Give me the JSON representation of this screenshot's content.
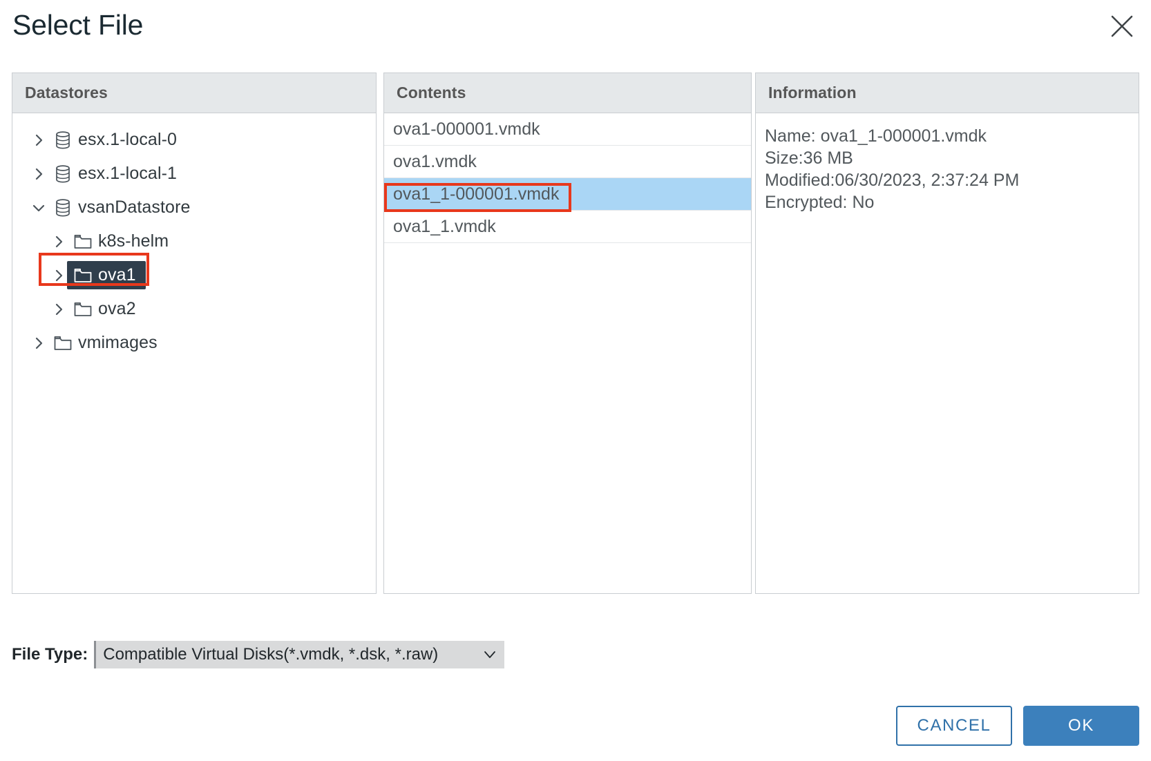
{
  "dialog": {
    "title": "Select File",
    "close_icon": "close-icon"
  },
  "panels": {
    "datastores": {
      "header": "Datastores",
      "tree": [
        {
          "label": "esx.1-local-0",
          "icon": "datastore-icon",
          "level": 0,
          "expanded": false,
          "selected": false
        },
        {
          "label": "esx.1-local-1",
          "icon": "datastore-icon",
          "level": 0,
          "expanded": false,
          "selected": false
        },
        {
          "label": "vsanDatastore",
          "icon": "datastore-icon",
          "level": 0,
          "expanded": true,
          "selected": false
        },
        {
          "label": "k8s-helm",
          "icon": "folder-icon",
          "level": 1,
          "expanded": false,
          "selected": false
        },
        {
          "label": "ova1",
          "icon": "folder-icon",
          "level": 1,
          "expanded": false,
          "selected": true
        },
        {
          "label": "ova2",
          "icon": "folder-icon",
          "level": 1,
          "expanded": false,
          "selected": false
        },
        {
          "label": "vmimages",
          "icon": "folder-icon",
          "level": 0,
          "expanded": false,
          "selected": false
        }
      ]
    },
    "contents": {
      "header": "Contents",
      "files": [
        {
          "name": "ova1-000001.vmdk",
          "selected": false
        },
        {
          "name": "ova1.vmdk",
          "selected": false
        },
        {
          "name": "ova1_1-000001.vmdk",
          "selected": true
        },
        {
          "name": "ova1_1.vmdk",
          "selected": false
        }
      ]
    },
    "information": {
      "header": "Information",
      "lines": [
        "Name: ova1_1-000001.vmdk",
        "Size:36 MB",
        "Modified:06/30/2023, 2:37:24 PM",
        "Encrypted: No"
      ]
    }
  },
  "file_type": {
    "label": "File Type:",
    "value": "Compatible Virtual Disks(*.vmdk, *.dsk, *.raw)",
    "caret_icon": "chevron-down-icon"
  },
  "footer": {
    "cancel_label": "CANCEL",
    "ok_label": "OK"
  },
  "colors": {
    "accent": "#3c80bc",
    "link": "#3071a9",
    "selection_blue": "#aad6f5",
    "selection_navy": "#2f3e4c",
    "panel_header_bg": "#e5e8ea",
    "annotation_red": "#e8381c"
  }
}
